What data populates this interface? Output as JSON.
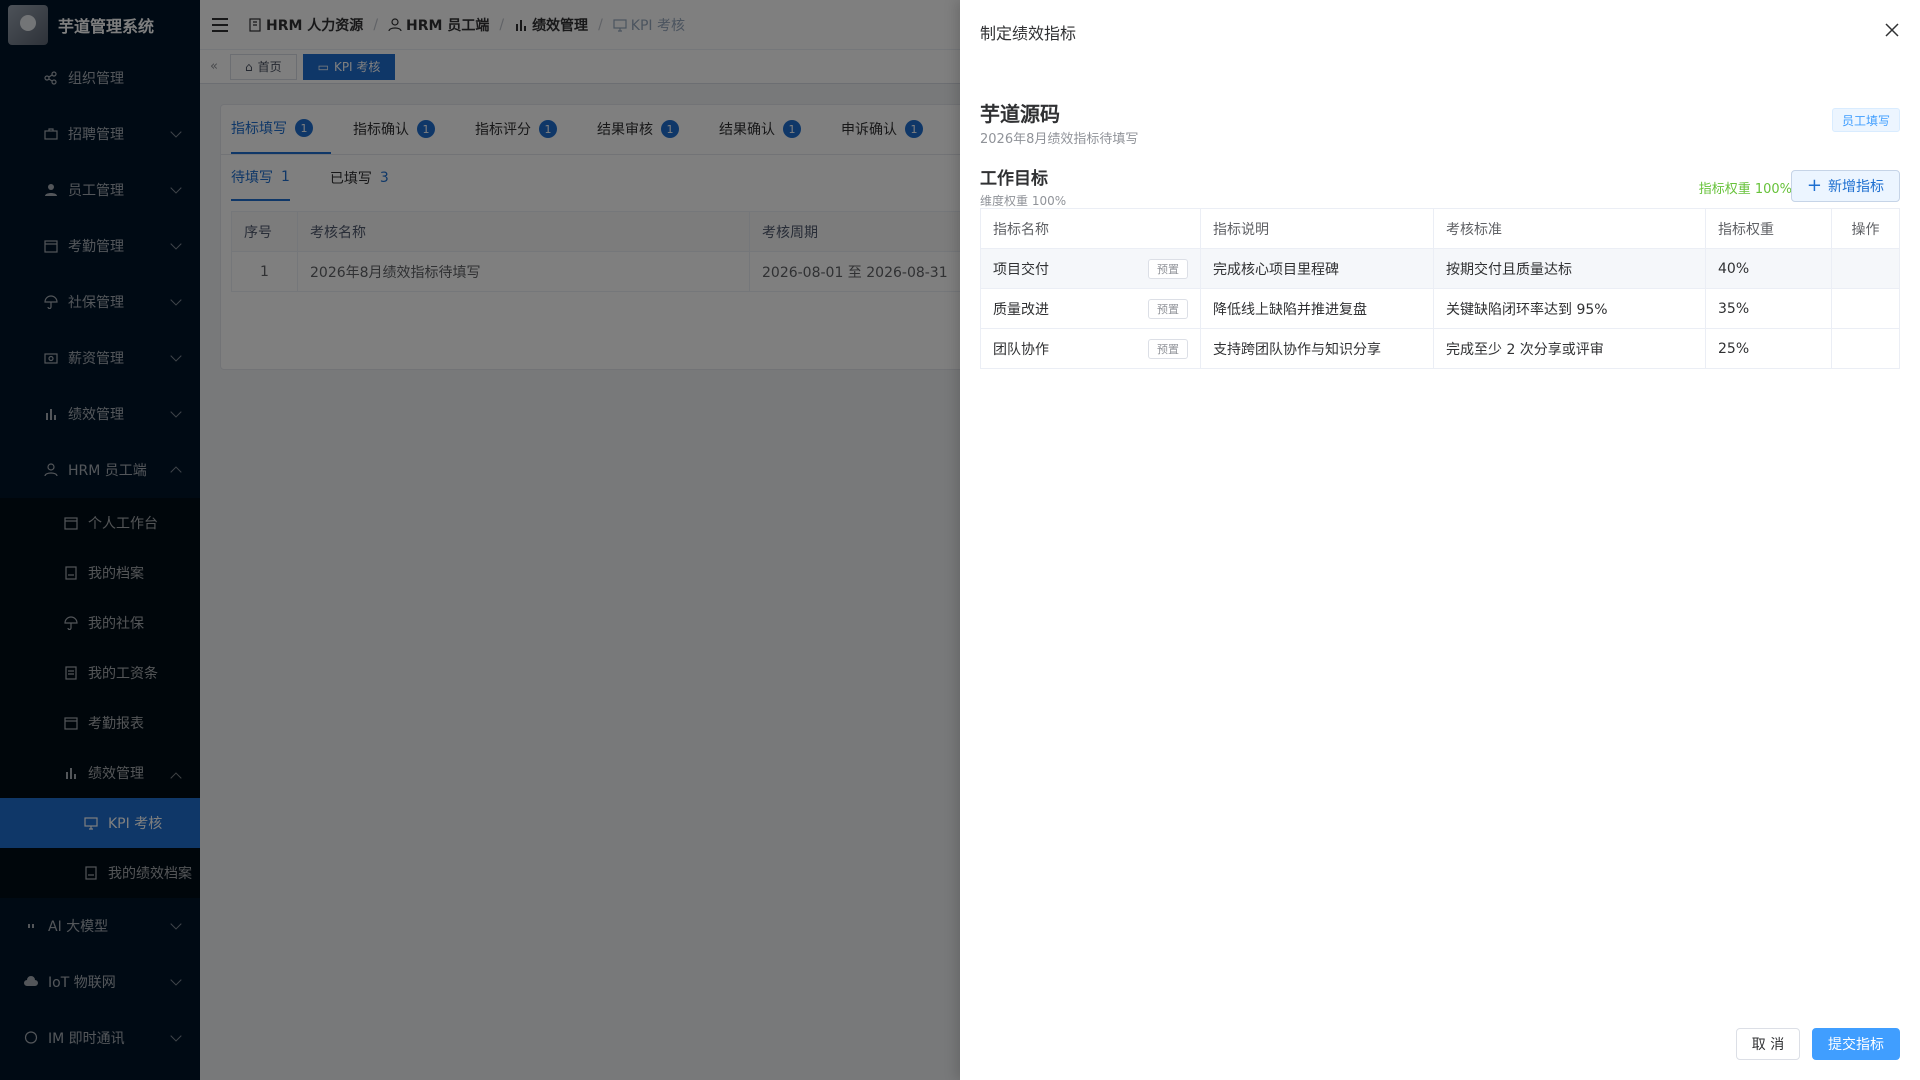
{
  "app": {
    "title": "芋道管理系统"
  },
  "sidebar": {
    "items": [
      {
        "label": "组织管理",
        "icon": "share-icon"
      },
      {
        "label": "招聘管理",
        "icon": "briefcase-icon"
      },
      {
        "label": "员工管理",
        "icon": "user-icon"
      },
      {
        "label": "考勤管理",
        "icon": "calendar-icon"
      },
      {
        "label": "社保管理",
        "icon": "umbrella-icon"
      },
      {
        "label": "薪资管理",
        "icon": "money-icon"
      },
      {
        "label": "绩效管理",
        "icon": "bar-chart-icon"
      },
      {
        "label": "HRM 员工端",
        "icon": "user-outline-icon"
      }
    ],
    "hrm_children": [
      {
        "label": "个人工作台",
        "icon": "calendar-icon"
      },
      {
        "label": "我的档案",
        "icon": "file-icon"
      },
      {
        "label": "我的社保",
        "icon": "umbrella-icon"
      },
      {
        "label": "我的工资条",
        "icon": "document-icon"
      },
      {
        "label": "考勤报表",
        "icon": "calendar-icon"
      },
      {
        "label": "绩效管理",
        "icon": "bar-chart-icon"
      }
    ],
    "perf_children": [
      {
        "label": "KPI 考核",
        "icon": "monitor-icon"
      },
      {
        "label": "我的绩效档案",
        "icon": "file-icon"
      }
    ],
    "bottom_items": [
      {
        "label": "AI 大模型",
        "icon": "ai-icon"
      },
      {
        "label": "IoT 物联网",
        "icon": "cloud-icon"
      },
      {
        "label": "IM 即时通讯",
        "icon": "chat-icon"
      }
    ]
  },
  "breadcrumb": {
    "items": [
      "HRM 人力资源",
      "HRM 员工端",
      "绩效管理",
      "KPI 考核"
    ]
  },
  "tags": {
    "home": "首页",
    "current": "KPI 考核"
  },
  "page": {
    "tabs": [
      {
        "label": "指标填写",
        "badge": "1"
      },
      {
        "label": "指标确认",
        "badge": "1"
      },
      {
        "label": "指标评分",
        "badge": "1"
      },
      {
        "label": "结果审核",
        "badge": "1"
      },
      {
        "label": "结果确认",
        "badge": "1"
      },
      {
        "label": "申诉确认",
        "badge": "1"
      }
    ],
    "subtabs": [
      {
        "label": "待填写",
        "count": "1"
      },
      {
        "label": "已填写",
        "count": "3"
      }
    ],
    "table": {
      "headers": [
        "序号",
        "考核名称",
        "考核周期"
      ],
      "rows": [
        {
          "no": "1",
          "name": "2026年8月绩效指标待填写",
          "period": "2026-08-01 至 2026-08-31"
        }
      ]
    }
  },
  "drawer": {
    "title": "制定绩效指标",
    "employee_name": "芋道源码",
    "employee_sub": "2026年8月绩效指标待填写",
    "status_tag": "员工填写",
    "section_title": "工作目标",
    "section_weight": "维度权重 100%",
    "weight_info": "指标权重 100%",
    "add_button": "新增指标",
    "table": {
      "headers": [
        "指标名称",
        "指标说明",
        "考核标准",
        "指标权重",
        "操作"
      ],
      "rows": [
        {
          "name": "项目交付",
          "preset": "预置",
          "desc": "完成核心项目里程碑",
          "standard": "按期交付且质量达标",
          "weight": "40%"
        },
        {
          "name": "质量改进",
          "preset": "预置",
          "desc": "降低线上缺陷并推进复盘",
          "standard": "关键缺陷闭环率达到 95%",
          "weight": "35%"
        },
        {
          "name": "团队协作",
          "preset": "预置",
          "desc": "支持跨团队协作与知识分享",
          "standard": "完成至少 2 次分享或评审",
          "weight": "25%"
        }
      ]
    },
    "cancel_button": "取 消",
    "submit_button": "提交指标"
  }
}
